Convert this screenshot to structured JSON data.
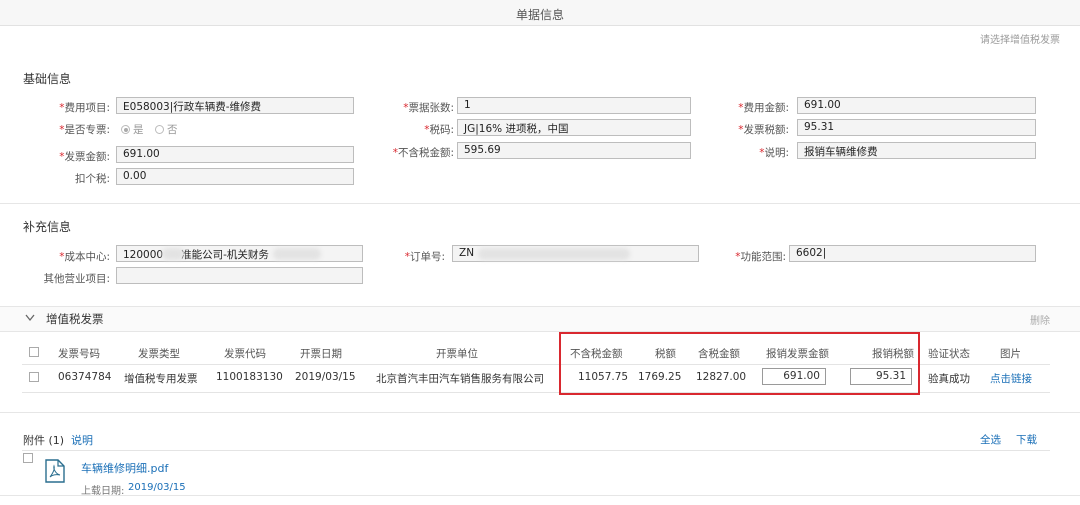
{
  "window": {
    "title": "单据信息",
    "top_link": "请选择增值税发票"
  },
  "basic": {
    "title": "基础信息",
    "fields": [
      {
        "label": "费用项目:",
        "required": true,
        "value": "E058003|行政车辆费-维修费"
      },
      {
        "label": "票据张数:",
        "required": true,
        "value": "1"
      },
      {
        "label": "费用金额:",
        "required": true,
        "value": "691.00"
      },
      {
        "label": "是否专票:",
        "required": true,
        "radio_yes": "是",
        "radio_no": "否"
      },
      {
        "label": "税码:",
        "required": true,
        "value": "JG|16% 进项税，中国"
      },
      {
        "label": "发票税额:",
        "required": true,
        "value": "95.31"
      },
      {
        "label": "发票金额:",
        "required": true,
        "value": "691.00"
      },
      {
        "label": "不含税金额:",
        "required": true,
        "value": "595.69"
      },
      {
        "label": "说明:",
        "required": true,
        "value": "报销车辆维修费"
      },
      {
        "label": "扣个税:",
        "required": false,
        "value": "0.00"
      }
    ]
  },
  "extra": {
    "title": "补充信息",
    "cost_center": {
      "label": "成本中心:",
      "value": "120000",
      "value_tail": "准能公司-机关财务"
    },
    "order_no": {
      "label": "订单号:",
      "value": "ZN"
    },
    "func_range": {
      "label": "功能范围:",
      "value": "6602|"
    },
    "other_biz": {
      "label": "其他营业项目:",
      "value": ""
    }
  },
  "vat": {
    "title": "增值税发票",
    "delete_label": "删除",
    "headers": [
      "发票号码",
      "发票类型",
      "发票代码",
      "开票日期",
      "开票单位",
      "不含税金额",
      "税额",
      "含税金额",
      "报销发票金额",
      "报销税额",
      "验证状态",
      "图片"
    ],
    "row": {
      "invoice_no": "06374784",
      "type": "增值税专用发票",
      "code": "1100183130",
      "date": "2019/03/15",
      "issuer": "北京首汽丰田汽车销售服务有限公司",
      "amount_ex_tax": "11057.75",
      "tax": "1769.25",
      "amount_inc_tax": "12827.00",
      "reimb_amount": "691.00",
      "reimb_tax": "95.31",
      "status": "验真成功",
      "image_link": "点击链接"
    }
  },
  "attachments": {
    "title": "附件 (1)",
    "desc_link": "说明",
    "select_all": "全选",
    "download": "下载",
    "file_name": "车辆维修明细.pdf",
    "upload_label": "上载日期:",
    "upload_date": "2019/03/15"
  }
}
